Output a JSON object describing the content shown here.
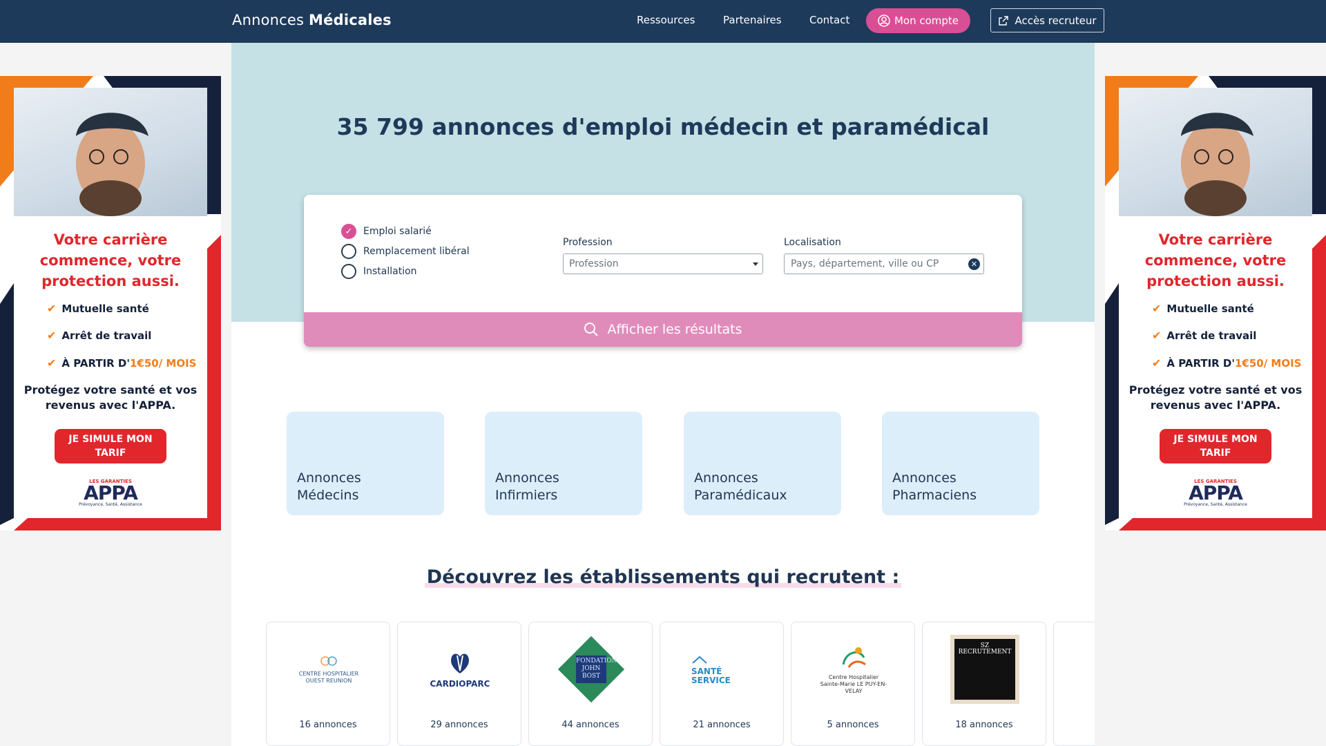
{
  "nav": {
    "brand_light": "Annonces",
    "brand_bold": "Médicales",
    "links": [
      "Ressources",
      "Partenaires",
      "Contact"
    ],
    "account_label": "Mon compte",
    "recruiter_label": "Accès recruteur"
  },
  "hero": {
    "count_bold": "35 799 annonces",
    "title_rest": " d'emploi médecin et paramédical"
  },
  "search": {
    "contract_types": [
      {
        "label": "Emploi salarié",
        "checked": true
      },
      {
        "label": "Remplacement libéral",
        "checked": false
      },
      {
        "label": "Installation",
        "checked": false
      }
    ],
    "profession_label": "Profession",
    "profession_value": "Profession",
    "location_label": "Localisation",
    "location_placeholder": "Pays, département, ville ou CP",
    "submit_label": "Afficher les résultats"
  },
  "categories": [
    {
      "line1": "Annonces",
      "line2": "Médecins"
    },
    {
      "line1": "Annonces",
      "line2": "Infirmiers"
    },
    {
      "line1": "Annonces",
      "line2": "Paramédicaux"
    },
    {
      "line1": "Annonces",
      "line2": "Pharmaciens"
    }
  ],
  "establishments_title": "Découvrez les établissements qui recrutent :",
  "establishments": [
    {
      "logo_text": "CENTRE HOSPITALIER OUEST REUNION",
      "count": "16 annonces"
    },
    {
      "logo_text": "CARDIOPARC",
      "count": "29 annonces"
    },
    {
      "logo_text": "FONDATION JOHN BOST",
      "count": "44 annonces"
    },
    {
      "logo_text": "SANTÉ SERVICE",
      "count": "21 annonces"
    },
    {
      "logo_text": "Centre Hospitalier Sainte-Marie LE PUY-EN-VELAY",
      "count": "5 annonces"
    },
    {
      "logo_text": "SZ RECRUTEMENT",
      "count": "18 annonces"
    }
  ],
  "ad": {
    "headline": "Votre carrière commence, votre protection aussi.",
    "bullet1": "Mutuelle santé",
    "bullet2": "Arrêt de travail",
    "bullet3_prefix": "À PARTIR D'",
    "bullet3_price": "1€50/ MOIS",
    "paragraph": "Protégez votre santé et vos revenus avec l'APPA.",
    "cta": "JE SIMULE MON TARIF",
    "logo_small": "LES GARANTIES",
    "logo_big": "APPA",
    "logo_tag": "Prévoyance, Santé, Assistance"
  },
  "colors": {
    "navy": "#1e3a5a",
    "pink": "#d94f95",
    "hero_bg": "#c5e1e5",
    "tile_bg": "#ddeefb",
    "ad_red": "#e1262c",
    "ad_orange": "#f07d1a"
  }
}
